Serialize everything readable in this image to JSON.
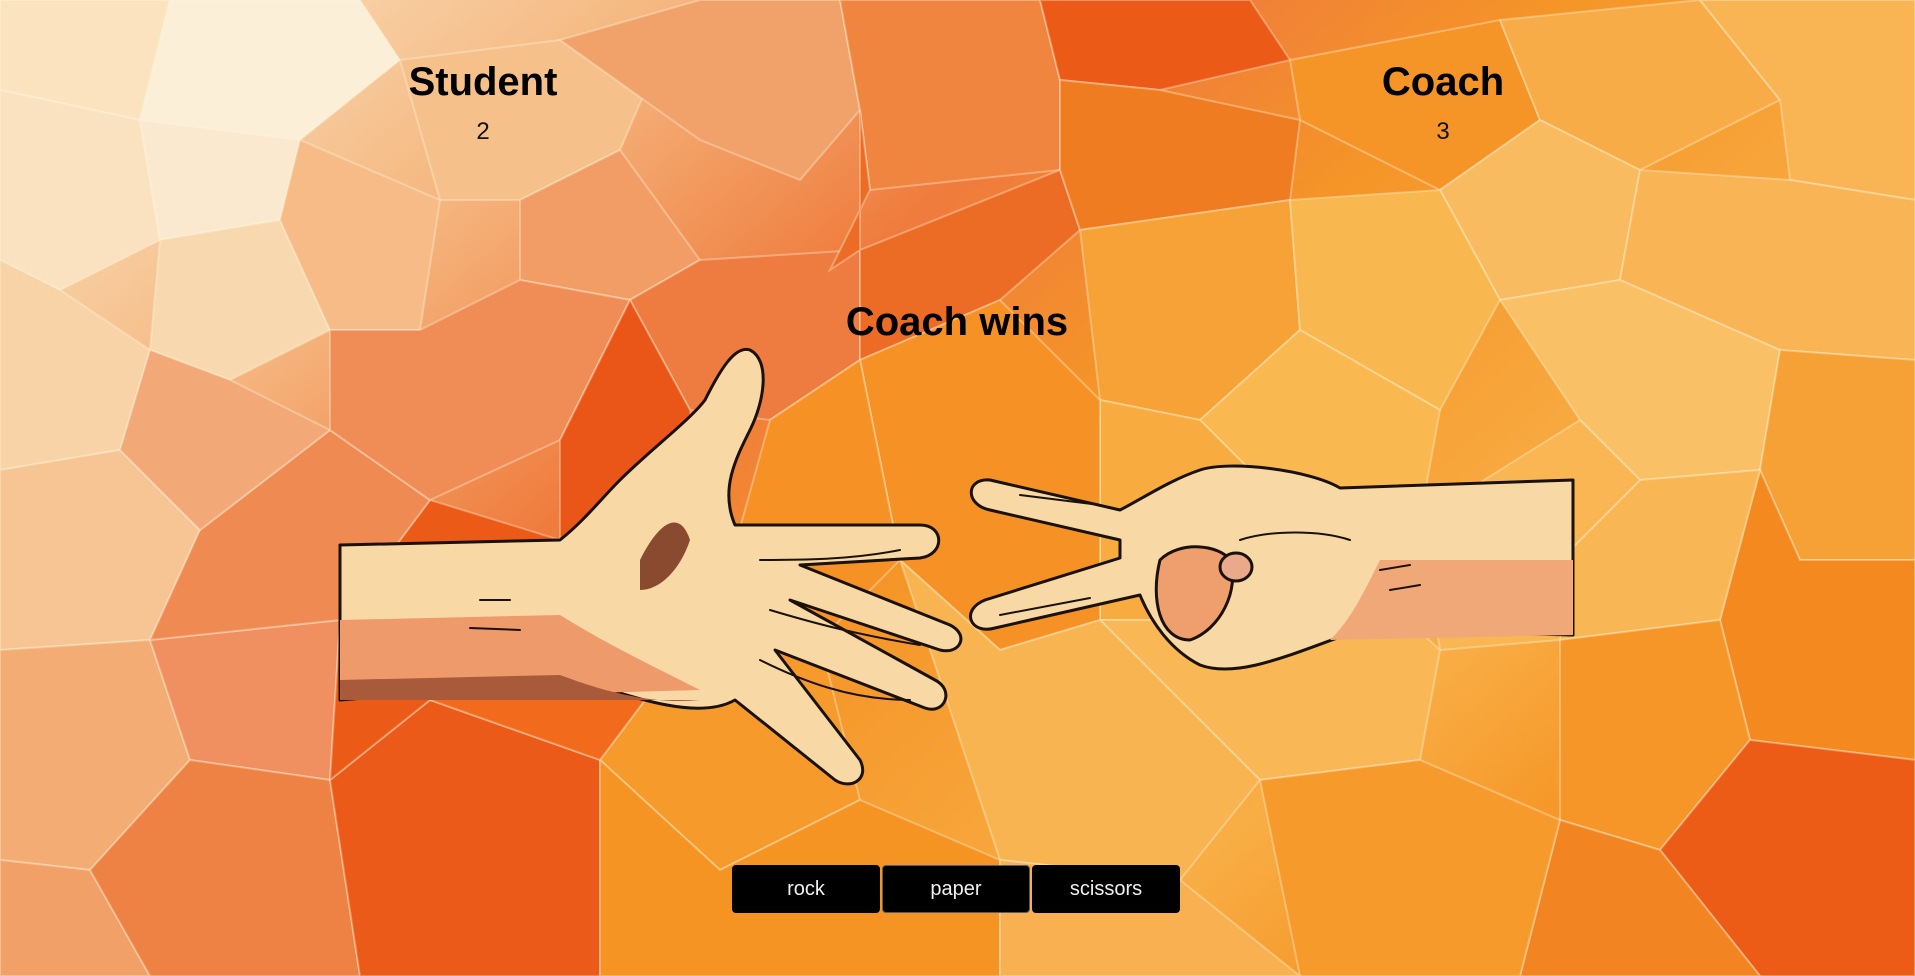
{
  "players": {
    "student": {
      "name": "Student",
      "score": "2"
    },
    "coach": {
      "name": "Coach",
      "score": "3"
    }
  },
  "result": "Coach wins",
  "plays": {
    "student": "paper",
    "coach": "scissors"
  },
  "controls": [
    {
      "label": "rock"
    },
    {
      "label": "paper"
    },
    {
      "label": "scissors"
    }
  ],
  "theme": {
    "bg_light": "#fbe6c4",
    "bg_mid": "#f59a3c",
    "bg_dark": "#ec5a16",
    "button": "#000000",
    "button_text": "#f0f0f0"
  }
}
